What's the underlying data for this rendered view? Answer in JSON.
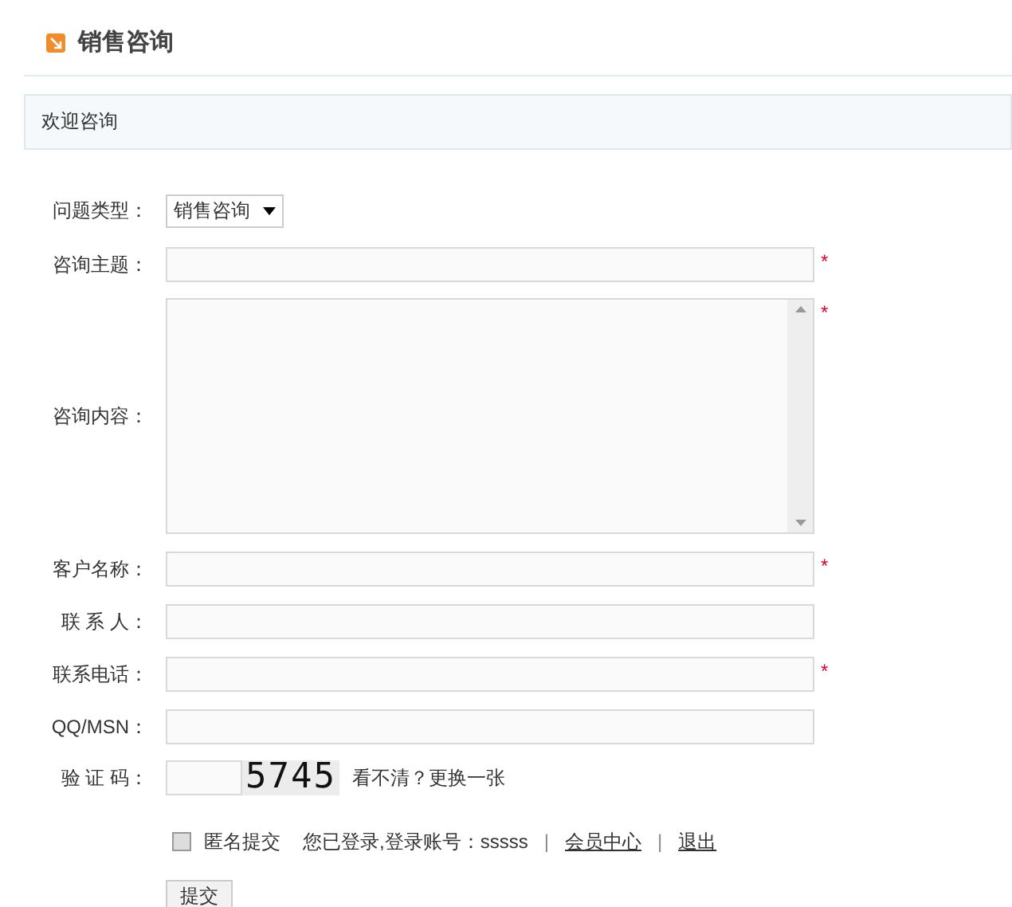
{
  "page_title": "销售咨询",
  "welcome": "欢迎咨询",
  "fields": [
    {
      "kind": "select",
      "label": "问题类型：",
      "value": "销售咨询"
    },
    {
      "kind": "text",
      "label": "咨询主题：",
      "required_mark": "*"
    },
    {
      "kind": "textarea",
      "label": "咨询内容：",
      "required_mark": "*"
    },
    {
      "kind": "text",
      "label": "客户名称：",
      "required_mark": "*"
    },
    {
      "kind": "text",
      "label": "联 系 人："
    },
    {
      "kind": "text",
      "label": "联系电话：",
      "required_mark": "*"
    },
    {
      "kind": "text",
      "label": "QQ/MSN："
    },
    {
      "kind": "captcha",
      "label": "验 证 码：",
      "captcha_text": "5745",
      "refresh_link": "看不清？更换一张"
    }
  ],
  "anonymous": {
    "label": "匿名提交",
    "checked": false
  },
  "login_info": "您已登录,登录账号：sssss",
  "separators": [
    "|",
    "|"
  ],
  "links": [
    "会员中心",
    "退出"
  ],
  "submit": "提交"
}
